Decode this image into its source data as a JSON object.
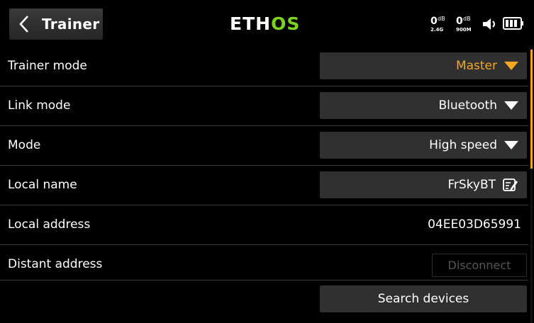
{
  "header": {
    "title": "Trainer",
    "logo_left": "ETH",
    "logo_right": "OS",
    "rssi": [
      {
        "value": "0",
        "unit": "dB",
        "band": "2.4G"
      },
      {
        "value": "0",
        "unit": "dB",
        "band": "900M"
      }
    ]
  },
  "rows": {
    "trainer_mode": {
      "label": "Trainer mode",
      "value": "Master"
    },
    "link_mode": {
      "label": "Link mode",
      "value": "Bluetooth"
    },
    "mode": {
      "label": "Mode",
      "value": "High speed"
    },
    "local_name": {
      "label": "Local name",
      "value": "FrSkyBT"
    },
    "local_address": {
      "label": "Local address",
      "value": "04EE03D65991"
    },
    "distant_address": {
      "label": "Distant address",
      "button": "Disconnect"
    }
  },
  "search_button": "Search devices",
  "colors": {
    "accent": "#f5a623",
    "logo_green": "#7ed321",
    "field_bg": "#303030"
  }
}
